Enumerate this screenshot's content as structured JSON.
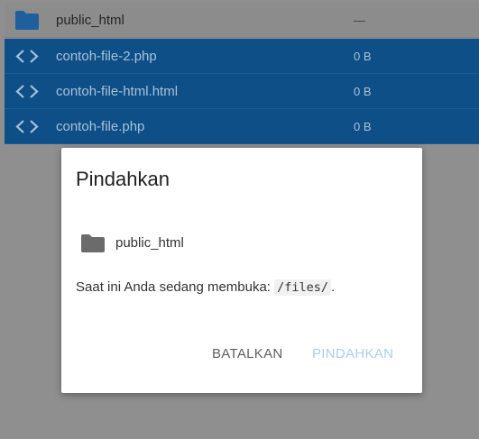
{
  "file_list": {
    "folder_row": {
      "name": "public_html",
      "size": "—",
      "icon": "folder-icon"
    },
    "selected_rows": [
      {
        "name": "contoh-file-2.php",
        "size": "0 B",
        "icon": "code-icon"
      },
      {
        "name": "contoh-file-html.html",
        "size": "0 B",
        "icon": "code-icon"
      },
      {
        "name": "contoh-file.php",
        "size": "0 B",
        "icon": "code-icon"
      }
    ]
  },
  "dialog": {
    "title": "Pindahkan",
    "destination": {
      "name": "public_html",
      "icon": "folder-icon"
    },
    "info_text": "Saat ini Anda sedang membuka: ",
    "info_path": "/files/",
    "info_suffix": ".",
    "cancel_label": "BATALKAN",
    "move_label": "PINDAHKAN"
  },
  "colors": {
    "selection_background": "#0d4f86",
    "overlay_background": "#8f8f8f",
    "move_button_disabled": "#a7cfee",
    "folder_icon": "#1e5f9e"
  }
}
